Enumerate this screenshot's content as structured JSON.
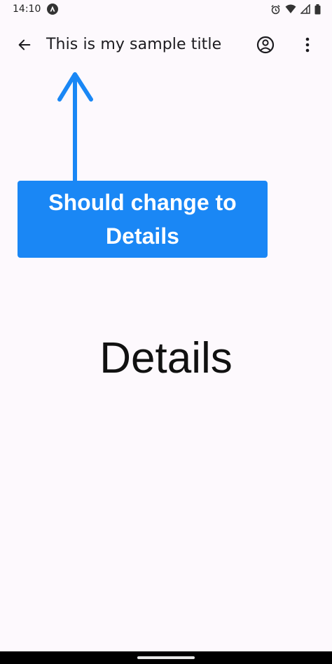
{
  "status_bar": {
    "time": "14:10",
    "icons": [
      "app-notification-icon",
      "alarm-icon",
      "wifi-icon",
      "signal-icon",
      "battery-icon"
    ]
  },
  "app_bar": {
    "title": "This is my sample title",
    "icons": [
      "back-arrow-icon",
      "account-circle-icon",
      "more-vert-icon"
    ]
  },
  "annotation": {
    "text": "Should change to Details",
    "color": "#1a87f5"
  },
  "content": {
    "text": "Details"
  }
}
